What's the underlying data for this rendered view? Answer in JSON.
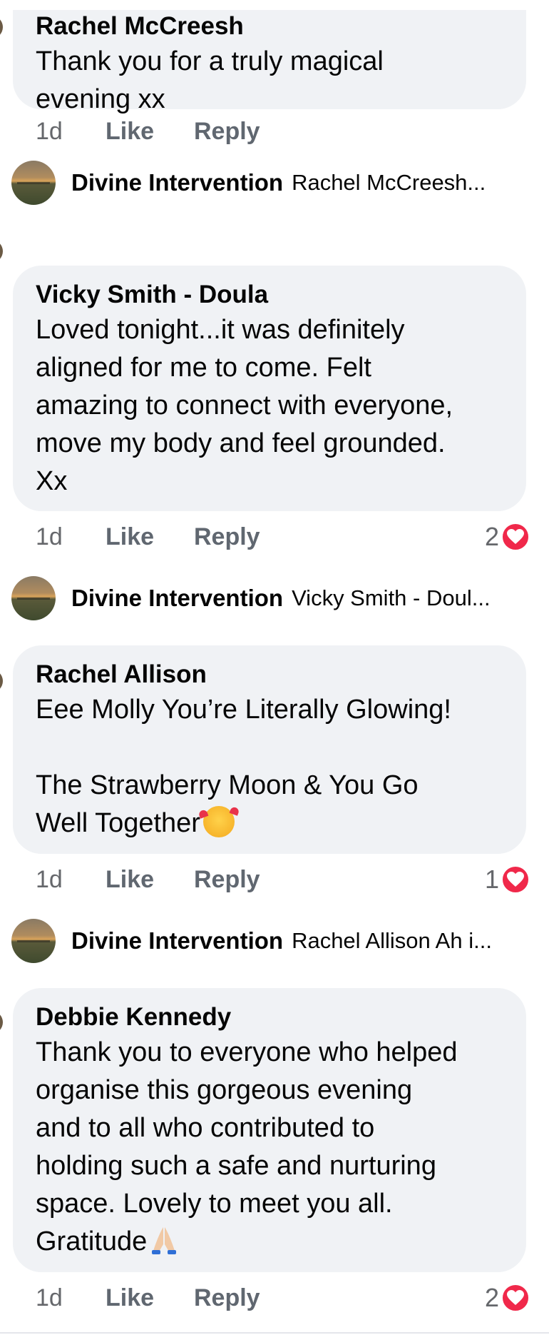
{
  "comments": [
    {
      "author": "Rachel McCreesh",
      "text": "Thank you for a truly magical\nevening xx",
      "time": "1d",
      "like": "Like",
      "reply": "Reply",
      "reaction_count": ""
    },
    {
      "author": "Vicky Smith - Doula",
      "text": "Loved tonight...it was definitely\naligned for me to come. Felt\namazing to connect with everyone,\nmove my body and feel grounded.\nXx",
      "time": "1d",
      "like": "Like",
      "reply": "Reply",
      "reaction_count": "2"
    },
    {
      "author": "Rachel Allison",
      "text_line1": "Eee Molly You’re Literally Glowing!",
      "text_rest": "The Strawberry Moon & You Go\nWell Together",
      "emoji": "smiling-face-with-hearts-icon",
      "time": "1d",
      "like": "Like",
      "reply": "Reply",
      "reaction_count": "1"
    },
    {
      "author": "Debbie Kennedy",
      "text": "Thank you to everyone who helped\norganise this gorgeous evening\nand to all who contributed to\nholding such a safe and nurturing\nspace. Lovely to meet you all.\nGratitude",
      "emoji": "folded-hands-icon",
      "time": "1d",
      "like": "Like",
      "reply": "Reply",
      "reaction_count": "2"
    }
  ],
  "replies": [
    {
      "author": "Divine Intervention",
      "preview": "Rachel McCreesh..."
    },
    {
      "author": "Divine Intervention",
      "preview": "Vicky Smith - Doul..."
    },
    {
      "author": "Divine Intervention",
      "preview": "Rachel Allison Ah i..."
    }
  ],
  "colors": {
    "bubble": "#f0f2f5",
    "heart": "#f0284a",
    "secondary_text": "#65676b"
  }
}
